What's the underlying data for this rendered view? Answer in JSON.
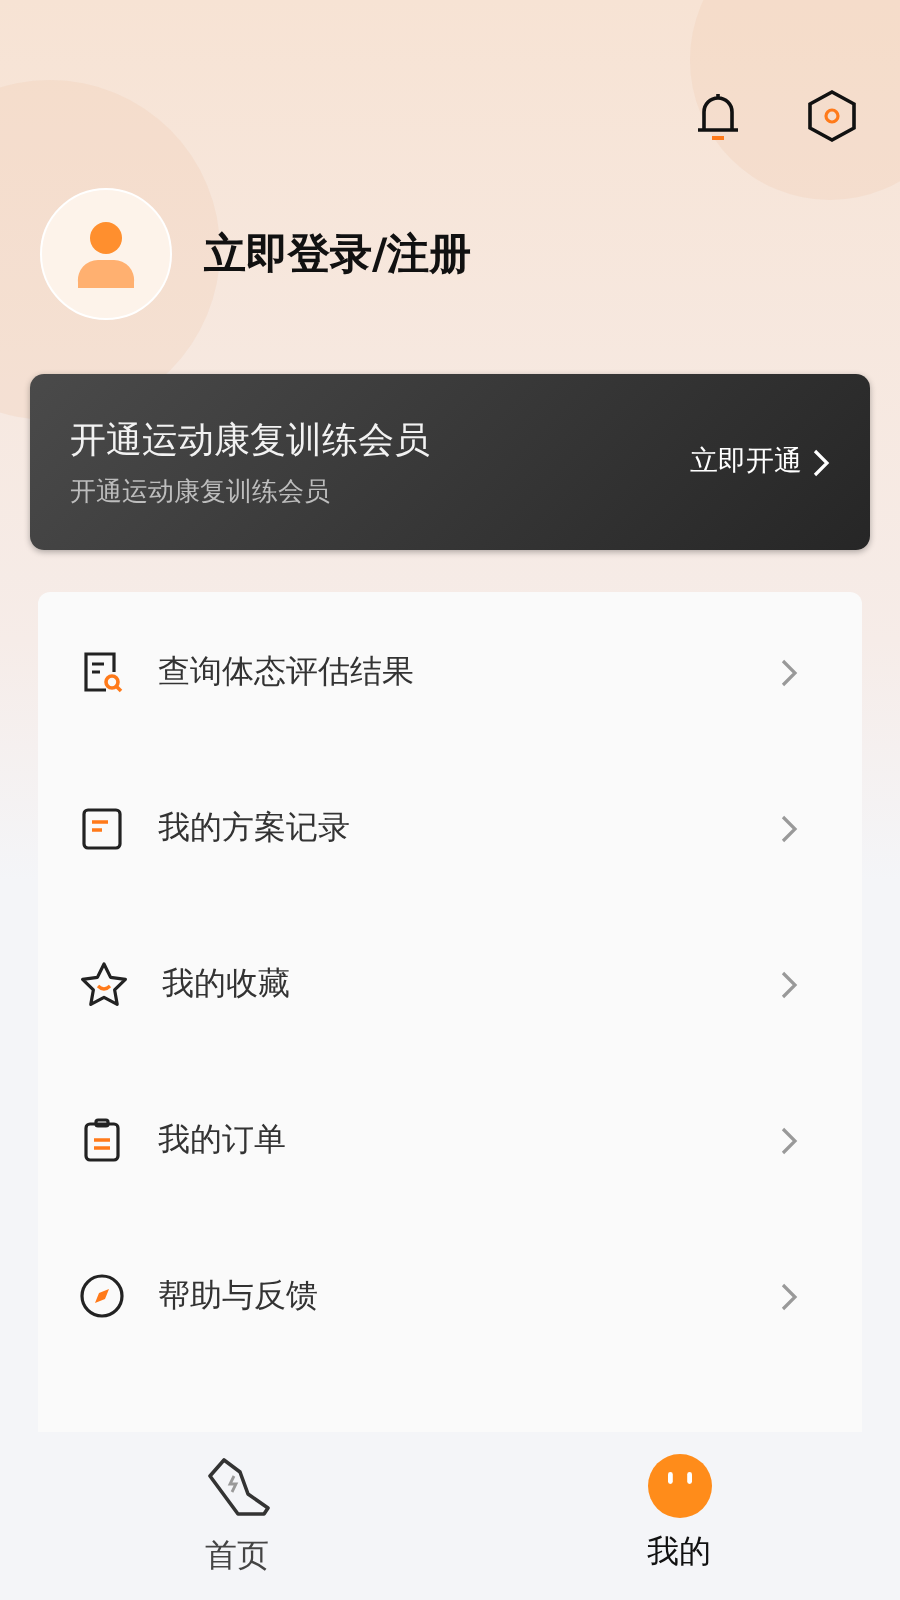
{
  "header": {
    "login_text": "立即登录/注册"
  },
  "member_card": {
    "title": "开通运动康复训练会员",
    "subtitle": "开通运动康复训练会员",
    "action": "立即开通"
  },
  "menu": [
    {
      "kind": "report",
      "label": "查询体态评估结果"
    },
    {
      "kind": "doc",
      "label": "我的方案记录"
    },
    {
      "kind": "star",
      "label": "我的收藏"
    },
    {
      "kind": "clipboard",
      "label": "我的订单"
    },
    {
      "kind": "compass",
      "label": "帮助与反馈"
    }
  ],
  "tab_bar": [
    {
      "kind": "shoe",
      "label": "首页",
      "selected": false
    },
    {
      "kind": "face",
      "label": "我的",
      "selected": true
    }
  ]
}
